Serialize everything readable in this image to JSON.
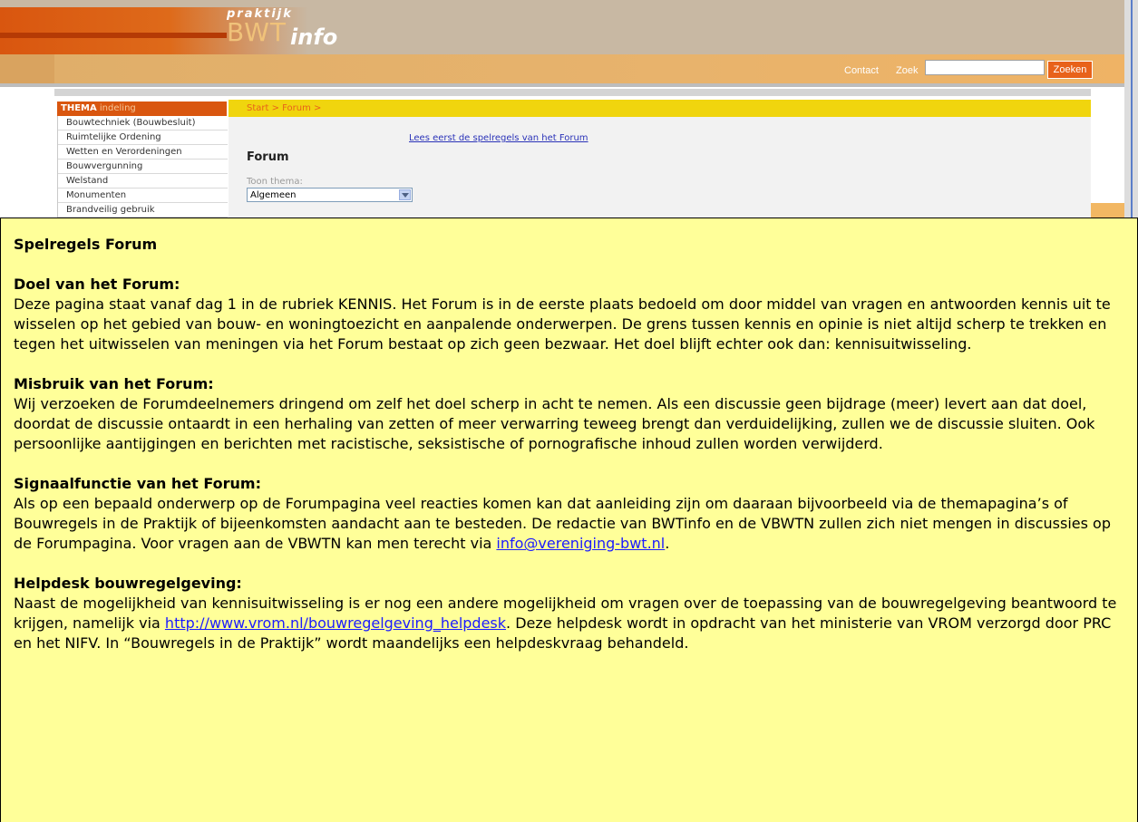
{
  "logo": {
    "praktijk": "praktijk",
    "bwt": "BWT",
    "info": "info"
  },
  "header": {
    "contact": "Contact",
    "zoek": "Zoek",
    "search_value": "",
    "search_button": "Zoeken"
  },
  "sidebar": {
    "header_bold": "THEMA",
    "header_rest": "indeling",
    "items": [
      {
        "label": "Bouwtechniek (Bouwbesluit)"
      },
      {
        "label": "Ruimtelijke Ordening"
      },
      {
        "label": "Wetten en Verordeningen"
      },
      {
        "label": "Bouwvergunning"
      },
      {
        "label": "Welstand"
      },
      {
        "label": "Monumenten"
      },
      {
        "label": "Brandveilig gebruik"
      }
    ]
  },
  "main": {
    "breadcrumb": "Start > Forum >",
    "rules_link": "Lees eerst de spelregels van het Forum",
    "title": "Forum",
    "toon_label": "Toon thema:",
    "selected_theme": "Algemeen"
  },
  "popup": {
    "title": "Spelregels Forum",
    "sections": [
      {
        "heading": "Doel van het Forum:",
        "text": "Deze pagina staat vanaf dag 1 in de rubriek KENNIS. Het Forum is in de eerste plaats bedoeld om door middel van vragen en antwoorden kennis uit te wisselen op het gebied van bouw- en woningtoezicht en aanpalende onderwerpen. De grens tussen kennis en opinie is niet altijd scherp te trekken en tegen het uitwisselen van meningen via het Forum bestaat op zich geen bezwaar. Het doel blijft echter ook dan: kennisuitwisseling."
      },
      {
        "heading": "Misbruik van het Forum:",
        "text": "Wij verzoeken de Forumdeelnemers dringend om zelf het doel scherp in acht te nemen. Als een discussie geen bijdrage (meer) levert aan dat doel, doordat de discussie ontaardt in een herhaling van zetten of meer verwarring teweeg brengt dan verduidelijking, zullen we de discussie sluiten. Ook persoonlijke aantijgingen en berichten met racistische, seksistische of pornografische inhoud zullen worden verwijderd."
      },
      {
        "heading": "Signaalfunctie van het Forum:",
        "text_before_link": "Als op een bepaald onderwerp op de Forumpagina veel reacties komen kan dat aanleiding zijn om daaraan bijvoorbeeld via de themapagina’s of Bouwregels in de Praktijk of bijeenkomsten aandacht aan te besteden. De redactie van BWTinfo en de VBWTN zullen zich niet mengen in discussies op de Forumpagina. Voor vragen aan de VBWTN kan men terecht via ",
        "link": "info@vereniging-bwt.nl",
        "text_after_link": "."
      },
      {
        "heading": "Helpdesk bouwregelgeving:",
        "text_before_link": "Naast de mogelijkheid van kennisuitwisseling is er nog een andere mogelijkheid om vragen over de toepassing van de bouwregelgeving beantwoord te krijgen, namelijk via ",
        "link": "http://www.vrom.nl/bouwregelgeving_helpdesk",
        "text_after_link": ". Deze helpdesk wordt in opdracht van het ministerie van VROM verzorgd door PRC en het NIFV. In “Bouwregels in de Praktijk” wordt maandelijks een helpdeskvraag behandeld."
      }
    ]
  }
}
